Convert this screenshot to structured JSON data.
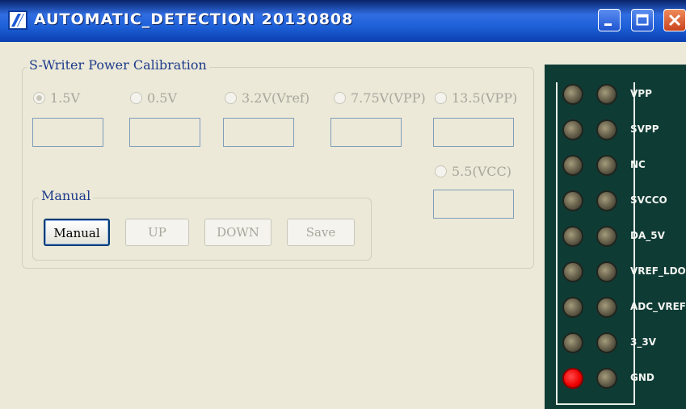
{
  "window": {
    "title": "AUTOMATIC_DETECTION 20130808"
  },
  "calibration": {
    "group_title": "S-Writer Power Calibration",
    "options": [
      {
        "label": "1.5V",
        "checked": true
      },
      {
        "label": "0.5V",
        "checked": false
      },
      {
        "label": "3.2V(Vref)",
        "checked": false
      },
      {
        "label": "7.75V(VPP)",
        "checked": false
      },
      {
        "label": "13.5(VPP)",
        "checked": false
      },
      {
        "label": "5.5(VCC)",
        "checked": false
      }
    ],
    "fields": [
      "",
      "",
      "",
      "",
      "",
      ""
    ]
  },
  "manual": {
    "group_title": "Manual",
    "buttons": {
      "manual": "Manual",
      "up": "UP",
      "down": "DOWN",
      "save": "Save"
    }
  },
  "pcb": {
    "labels": [
      "VPP",
      "SVPP",
      "NC",
      "SVCCO",
      "DA_5V",
      "VREF_LDO",
      "ADC_VREF",
      "3_3V",
      "GND"
    ]
  },
  "colors": {
    "titlebar": "#1d5fd6",
    "indicator": "#ee0000",
    "pcb": "#0f3b35"
  }
}
